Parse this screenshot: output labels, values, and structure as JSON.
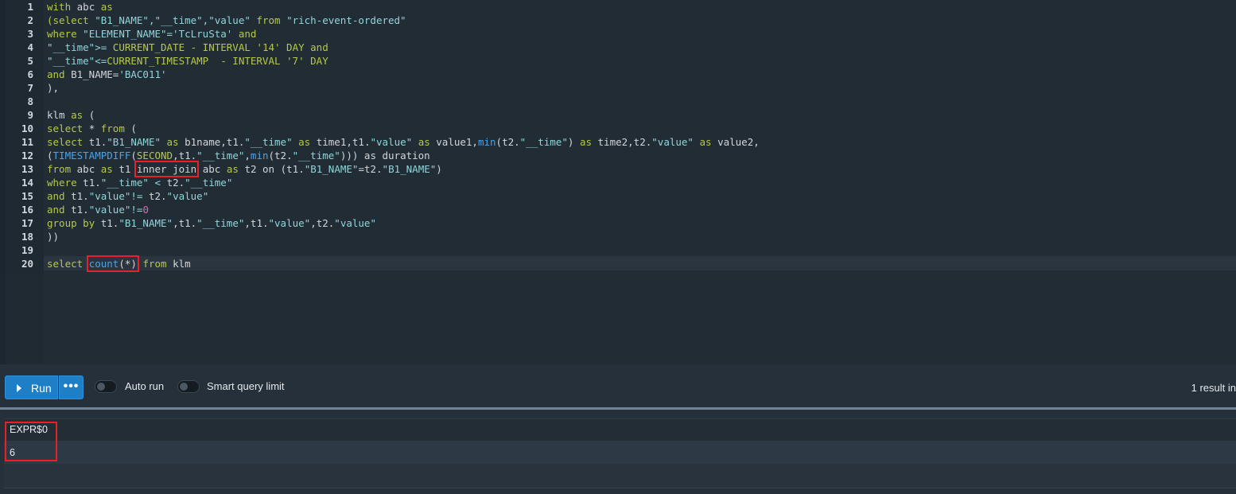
{
  "editor": {
    "line_numbers": [
      "1",
      "2",
      "3",
      "4",
      "5",
      "6",
      "7",
      "8",
      "9",
      "10",
      "11",
      "12",
      "13",
      "14",
      "15",
      "16",
      "17",
      "18",
      "19",
      "20"
    ],
    "code": {
      "l1": [
        "with",
        "abc",
        "as"
      ],
      "l2": [
        "(select",
        "\"B1_NAME\",\"__time\",\"value\"",
        "from",
        "\"rich-event-ordered\""
      ],
      "l3": [
        "where",
        "\"ELEMENT_NAME\"='TcLruSta'",
        "and"
      ],
      "l4": [
        "\"__time\">=",
        "CURRENT_DATE - INTERVAL '14' DAY and"
      ],
      "l5": [
        "\"__time\"<=",
        "CURRENT_TIMESTAMP  - INTERVAL '7' DAY"
      ],
      "l6": [
        "and",
        "B1_NAME=",
        "'BAC011'"
      ],
      "l7": "),",
      "l9": [
        "klm",
        "as",
        "("
      ],
      "l10": [
        "select",
        "*",
        "from",
        "("
      ],
      "l11": [
        "select",
        "t1.",
        "\"B1_NAME\"",
        "as",
        "b1name,t1.",
        "\"__time\"",
        "as",
        "time1,t1.",
        "\"value\"",
        "as",
        "value1,",
        "min",
        "(t2.",
        "\"__time\"",
        ")",
        "as",
        "time2,t2.",
        "\"value\"",
        "as",
        "value2,"
      ],
      "l12": [
        "(",
        "TIMESTAMPDIFF",
        "(",
        "SECOND",
        ",t1.",
        "\"__time\"",
        ",",
        "min",
        "(t2.",
        "\"__time\"",
        "))) as duration"
      ],
      "l13": [
        "from",
        "abc",
        "as",
        "t1",
        "inner join",
        "abc",
        "as",
        "t2 on (t1.",
        "\"B1_NAME\"",
        "=t2.",
        "\"B1_NAME\"",
        ")"
      ],
      "l14": [
        "where",
        "t1.",
        "\"__time\"",
        "<",
        "t2.",
        "\"__time\""
      ],
      "l15": [
        "and",
        "t1.",
        "\"value\"",
        "!=",
        "t2.",
        "\"value\""
      ],
      "l16": [
        "and",
        "t1.",
        "\"value\"",
        "!=",
        "0"
      ],
      "l17": [
        "group by",
        "t1.",
        "\"B1_NAME\"",
        ",t1.",
        "\"__time\"",
        ",t1.",
        "\"value\"",
        ",t2.",
        "\"value\""
      ],
      "l18": "))",
      "l20": [
        "select",
        "count",
        "(*)",
        "from",
        "klm"
      ]
    }
  },
  "toolbar": {
    "run_label": "Run",
    "more_label": "•••",
    "auto_run_label": "Auto run",
    "smart_limit_label": "Smart query limit",
    "result_info": "1 result in"
  },
  "results": {
    "columns": [
      "EXPR$0"
    ],
    "rows": [
      [
        "6"
      ]
    ]
  }
}
